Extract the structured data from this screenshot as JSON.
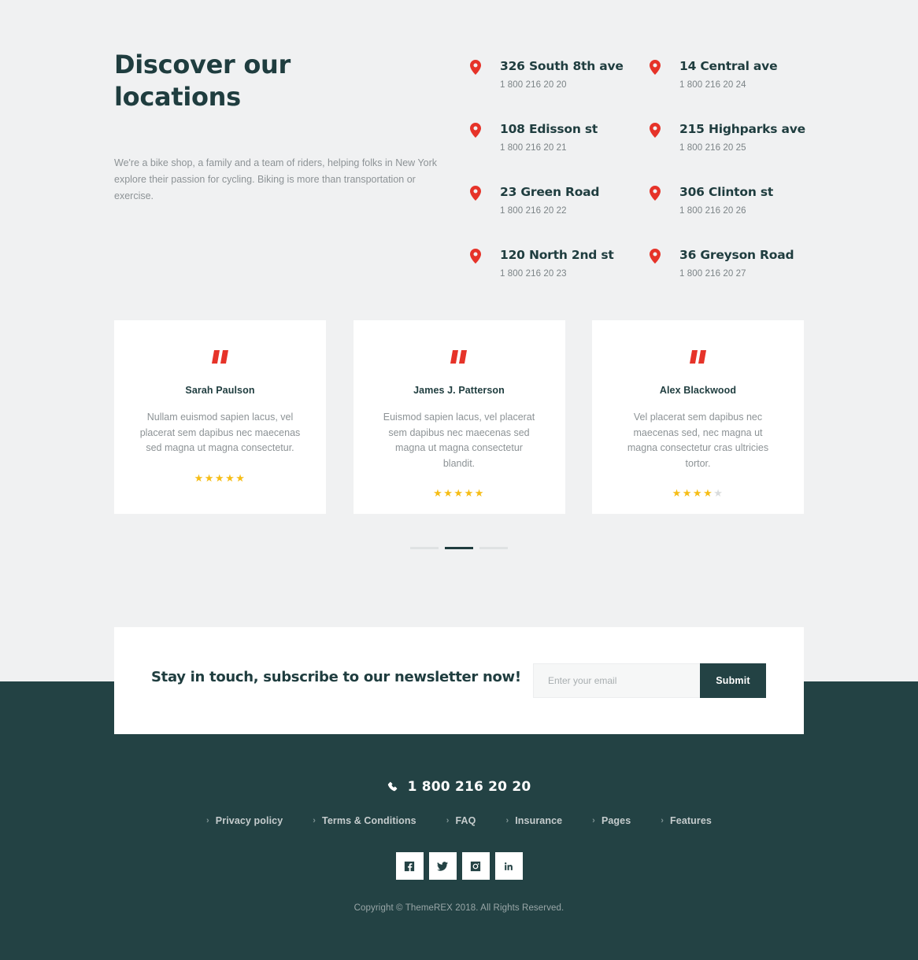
{
  "colors": {
    "page_bg": "#f0f1f2",
    "footer_bg": "#234244",
    "heading": "#1f3d3f",
    "body_text": "#8d9396",
    "accent_red": "#e63329",
    "star_gold": "#f6bd16",
    "star_off": "#d9dcdd",
    "card_bg": "#ffffff"
  },
  "locations": {
    "title": "Discover our locations",
    "description": "We're a bike shop, a family and a team of riders, helping folks in New York explore their passion for cycling. Biking is more than transportation or exercise.",
    "pin_icon": "map-pin-icon",
    "items": [
      {
        "address": "326 South 8th ave",
        "phone": "1 800 216 20 20"
      },
      {
        "address": "14 Central ave",
        "phone": "1 800 216 20 24"
      },
      {
        "address": "108 Edisson st",
        "phone": "1 800 216 20 21"
      },
      {
        "address": "215 Highparks ave",
        "phone": "1 800 216 20 25"
      },
      {
        "address": "23 Green Road",
        "phone": "1 800 216 20 22"
      },
      {
        "address": "306 Clinton st",
        "phone": "1 800 216 20 26"
      },
      {
        "address": "120 North 2nd st",
        "phone": "1 800 216 20 23"
      },
      {
        "address": "36 Greyson Road",
        "phone": "1 800 216 20 27"
      }
    ]
  },
  "testimonials": {
    "quote_icon": "quote-mark-icon",
    "cards": [
      {
        "name": "Sarah Paulson",
        "text": "Nullam euismod sapien lacus, vel placerat sem dapibus nec maecenas sed magna ut magna consectetur.",
        "rating": 5,
        "max_rating": 5
      },
      {
        "name": "James J. Patterson",
        "text": "Euismod sapien lacus, vel placerat sem dapibus nec maecenas sed magna ut magna consectetur blandit.",
        "rating": 5,
        "max_rating": 5
      },
      {
        "name": "Alex Blackwood",
        "text": "Vel placerat sem dapibus nec maecenas sed, nec magna ut magna consectetur cras ultricies tortor.",
        "rating": 4,
        "max_rating": 5
      }
    ],
    "carousel": {
      "slides": 3,
      "active_index": 1
    }
  },
  "newsletter": {
    "title": "Stay in touch, subscribe to our newsletter now!",
    "input_value": "",
    "input_placeholder": "Enter your email",
    "submit_label": "Submit"
  },
  "footer": {
    "phone_icon": "phone-icon",
    "phone": "1 800 216 20 20",
    "links": [
      {
        "label": "Privacy policy"
      },
      {
        "label": "Terms & Conditions"
      },
      {
        "label": "FAQ"
      },
      {
        "label": "Insurance"
      },
      {
        "label": "Pages"
      },
      {
        "label": "Features"
      }
    ],
    "chevron": "›",
    "socials": [
      {
        "name": "facebook-icon"
      },
      {
        "name": "twitter-icon"
      },
      {
        "name": "instagram-icon"
      },
      {
        "name": "linkedin-icon"
      }
    ],
    "copyright": "Copyright ©  ThemeREX 2018. All Rights Reserved."
  }
}
